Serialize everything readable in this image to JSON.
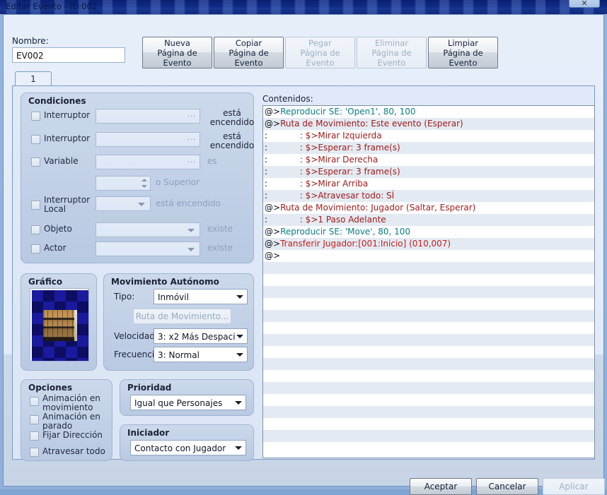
{
  "window": {
    "title": "Editar Evento - ID:002",
    "close_glyph": "✕",
    "close_icon": "close-icon"
  },
  "top": {
    "nombre_label": "Nombre:",
    "nombre_value": "EV002",
    "page_buttons": [
      {
        "label": "Nueva\nPágina de\nEvento",
        "enabled": true
      },
      {
        "label": "Copiar\nPágina de\nEvento",
        "enabled": true
      },
      {
        "label": "Pegar\nPágina de\nEvento",
        "enabled": false
      },
      {
        "label": "Eliminar\nPágina de\nEvento",
        "enabled": false
      },
      {
        "label": "Limpiar\nPágina de\nEvento",
        "enabled": true
      }
    ]
  },
  "tabs": [
    {
      "label": "1",
      "active": true
    }
  ],
  "condiciones": {
    "title": "Condiciones",
    "rows": [
      {
        "label": "Interruptor",
        "value": "",
        "suffix": "está\nencendido",
        "control": "text-ellipsis"
      },
      {
        "label": "Interruptor",
        "value": "",
        "suffix": "está\nencendido",
        "control": "text-ellipsis"
      },
      {
        "label": "Variable",
        "value": "",
        "suffix": "es",
        "control": "text-ellipsis"
      },
      {
        "label": "",
        "value": "",
        "suffix": "o Superior",
        "control": "spinner"
      },
      {
        "label": "Interruptor\nLocal",
        "value": "",
        "suffix": "está encendido",
        "control": "combo"
      },
      {
        "label": "Objeto",
        "value": "",
        "suffix": "existe",
        "control": "combo"
      },
      {
        "label": "Actor",
        "value": "",
        "suffix": "existe",
        "control": "combo"
      }
    ]
  },
  "grafico": {
    "title": "Gráfico",
    "sprite_name": "bookshelf-sprite"
  },
  "movimiento": {
    "title": "Movimiento Autónomo",
    "tipo_label": "Tipo:",
    "tipo_value": "Inmóvil",
    "ruta_button": "Ruta de Movimiento...",
    "velocidad_label": "Velocidad:",
    "velocidad_value": "3: x2 Más Despaci",
    "frecuencia_label": "Frecuencia:",
    "frecuencia_value": "3: Normal"
  },
  "opciones": {
    "title": "Opciones",
    "items": [
      {
        "label": "Animación en\nmovimiento",
        "checked": false
      },
      {
        "label": "Animación en\nparado",
        "checked": false
      },
      {
        "label": "Fijar Dirección",
        "checked": false
      },
      {
        "label": "Atravesar todo",
        "checked": false
      }
    ]
  },
  "prioridad": {
    "title": "Prioridad",
    "value": "Igual que Personajes"
  },
  "iniciador": {
    "title": "Iniciador",
    "value": "Contacto con Jugador"
  },
  "contenidos": {
    "label": "Contenidos:",
    "commands": [
      {
        "pre": "@>",
        "text": "Reproducir SE: 'Open1', 80, 100",
        "color": "teal"
      },
      {
        "pre": "@>",
        "text": "Ruta de Movimiento: Este evento (Esperar)",
        "color": "maroon"
      },
      {
        "pre": ":",
        "text": "            : $>Mirar Izquierda",
        "color": "maroon"
      },
      {
        "pre": ":",
        "text": "            : $>Esperar: 3 frame(s)",
        "color": "maroon"
      },
      {
        "pre": ":",
        "text": "            : $>Mirar Derecha",
        "color": "maroon"
      },
      {
        "pre": ":",
        "text": "            : $>Esperar: 3 frame(s)",
        "color": "maroon"
      },
      {
        "pre": ":",
        "text": "            : $>Mirar Arriba",
        "color": "maroon"
      },
      {
        "pre": ":",
        "text": "            : $>Atravesar todo: SÍ",
        "color": "maroon"
      },
      {
        "pre": "@>",
        "text": "Ruta de Movimiento: Jugador (Saltar, Esperar)",
        "color": "maroon"
      },
      {
        "pre": ":",
        "text": "            : $>1 Paso Adelante",
        "color": "maroon"
      },
      {
        "pre": "@>",
        "text": "Reproducir SE: 'Move', 80, 100",
        "color": "teal"
      },
      {
        "pre": "@>",
        "text": "Transferir Jugador:[001:Inicio] (010,007)",
        "color": "red"
      },
      {
        "pre": "@>",
        "text": "",
        "color": "maroon"
      }
    ],
    "empty_row_count": 16
  },
  "footer": {
    "accept_label": "Aceptar",
    "cancel_label": "Cancelar",
    "apply_label": "Aplicar",
    "apply_enabled": false
  },
  "colors": {
    "title_bar": "#102a86",
    "client_bg": "#e3ecf8",
    "group_bg": "#c4d2e8",
    "command_teal": "#0b7d86",
    "command_maroon": "#9e1a1a",
    "command_red": "#c0201f",
    "row_stripe": "#e4eaf2"
  }
}
